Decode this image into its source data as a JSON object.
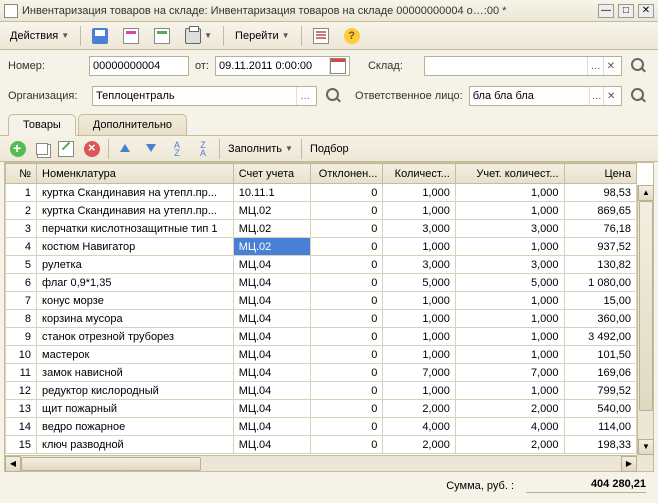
{
  "window_title": "Инвентаризация товаров на складе: Инвентаризация товаров на складе 00000000004 о…:00 *",
  "menu": {
    "actions": "Действия",
    "go": "Перейти"
  },
  "form": {
    "number_label": "Номер:",
    "number_value": "00000000004",
    "from_label": "от:",
    "date_value": "09.11.2011 0:00:00",
    "warehouse_label": "Склад:",
    "warehouse_value": "",
    "org_label": "Организация:",
    "org_value": "Теплоцентраль",
    "resp_label": "Ответственное лицо:",
    "resp_value": "бла бла бла"
  },
  "tabs": {
    "goods": "Товары",
    "extra": "Дополнительно"
  },
  "grid_actions": {
    "fill": "Заполнить",
    "pick": "Подбор"
  },
  "headers": {
    "n": "№",
    "nom": "Номенклатура",
    "acc": "Счет учета",
    "dev": "Отклонен...",
    "qty": "Количест...",
    "aqty": "Учет. количест...",
    "price": "Цена"
  },
  "rows": [
    {
      "n": "1",
      "nom": "куртка Скандинавия на утепл.пр...",
      "acc": "10.11.1",
      "dev": "0",
      "qty": "1,000",
      "aqty": "1,000",
      "price": "98,53"
    },
    {
      "n": "2",
      "nom": "куртка Скандинавия на утепл.пр...",
      "acc": "МЦ.02",
      "dev": "0",
      "qty": "1,000",
      "aqty": "1,000",
      "price": "869,65"
    },
    {
      "n": "3",
      "nom": "перчатки кислотнозащитные тип 1",
      "acc": "МЦ.02",
      "dev": "0",
      "qty": "3,000",
      "aqty": "3,000",
      "price": "76,18"
    },
    {
      "n": "4",
      "nom": "костюм Навигатор",
      "acc": "МЦ.02",
      "dev": "0",
      "qty": "1,000",
      "aqty": "1,000",
      "price": "937,52",
      "sel": true
    },
    {
      "n": "5",
      "nom": "рулетка",
      "acc": "МЦ.04",
      "dev": "0",
      "qty": "3,000",
      "aqty": "3,000",
      "price": "130,82"
    },
    {
      "n": "6",
      "nom": "флаг 0,9*1,35",
      "acc": "МЦ.04",
      "dev": "0",
      "qty": "5,000",
      "aqty": "5,000",
      "price": "1 080,00"
    },
    {
      "n": "7",
      "nom": "конус морзе",
      "acc": "МЦ.04",
      "dev": "0",
      "qty": "1,000",
      "aqty": "1,000",
      "price": "15,00"
    },
    {
      "n": "8",
      "nom": "корзина мусора",
      "acc": "МЦ.04",
      "dev": "0",
      "qty": "1,000",
      "aqty": "1,000",
      "price": "360,00"
    },
    {
      "n": "9",
      "nom": "станок отрезной труборез",
      "acc": "МЦ.04",
      "dev": "0",
      "qty": "1,000",
      "aqty": "1,000",
      "price": "3 492,00"
    },
    {
      "n": "10",
      "nom": "мастерок",
      "acc": "МЦ.04",
      "dev": "0",
      "qty": "1,000",
      "aqty": "1,000",
      "price": "101,50"
    },
    {
      "n": "11",
      "nom": "замок нависной",
      "acc": "МЦ.04",
      "dev": "0",
      "qty": "7,000",
      "aqty": "7,000",
      "price": "169,06"
    },
    {
      "n": "12",
      "nom": "редуктор кислородный",
      "acc": "МЦ.04",
      "dev": "0",
      "qty": "1,000",
      "aqty": "1,000",
      "price": "799,52"
    },
    {
      "n": "13",
      "nom": "щит пожарный",
      "acc": "МЦ.04",
      "dev": "0",
      "qty": "2,000",
      "aqty": "2,000",
      "price": "540,00"
    },
    {
      "n": "14",
      "nom": "ведро пожарное",
      "acc": "МЦ.04",
      "dev": "0",
      "qty": "4,000",
      "aqty": "4,000",
      "price": "114,00"
    },
    {
      "n": "15",
      "nom": "ключ разводной",
      "acc": "МЦ.04",
      "dev": "0",
      "qty": "2,000",
      "aqty": "2,000",
      "price": "198,33"
    }
  ],
  "footer": {
    "sum_label": "Сумма, руб. :",
    "sum_value": "404 280,21"
  }
}
